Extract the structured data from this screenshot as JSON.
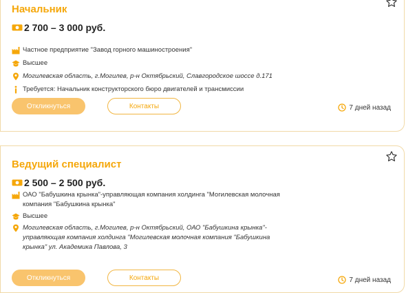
{
  "vacancies": [
    {
      "title": "Начальник",
      "salary": "2 700 – 3 000 руб.",
      "company": "Частное предприятие \"Завод горного машиностроения\"",
      "education": "Высшее",
      "address": "Могилевская область, г.Могилев, р-н Октябрьский, Славгородское шоссе д.171",
      "requirement": "Требуется: Начальник конструкторского бюро двигателей и трансмиссии",
      "apply_label": "Откликнуться",
      "contacts_label": "Контакты",
      "posted": "7 дней назад"
    },
    {
      "title": "Ведущий специалист",
      "salary": "2 500 – 2 500 руб.",
      "company": "ОАО \"Бабушкина крынка\"-управляющая компания холдинга \"Могилевская молочная компания \"Бабушкина крынка\"",
      "education": "Высшее",
      "address": "Могилевская область, г.Могилев, р-н Октябрьский, ОАО \"Бабушкина крынка\"-управляющая компания холдинга \"Могилевская молочная компания \"Бабушкина крынка\" ул. Академика Павлова, 3",
      "apply_label": "Откликнуться",
      "contacts_label": "Контакты",
      "posted": "7 дней назад"
    }
  ],
  "icons": {
    "salary": "money-icon",
    "company": "factory-icon",
    "education": "graduation-cap-icon",
    "address": "location-pin-icon",
    "requirement": "info-icon",
    "favorite": "star-icon",
    "posted": "clock-icon"
  },
  "colors": {
    "accent": "#f5a70a",
    "button_fill": "#f9c46d",
    "card_border": "#f1d9a6"
  }
}
